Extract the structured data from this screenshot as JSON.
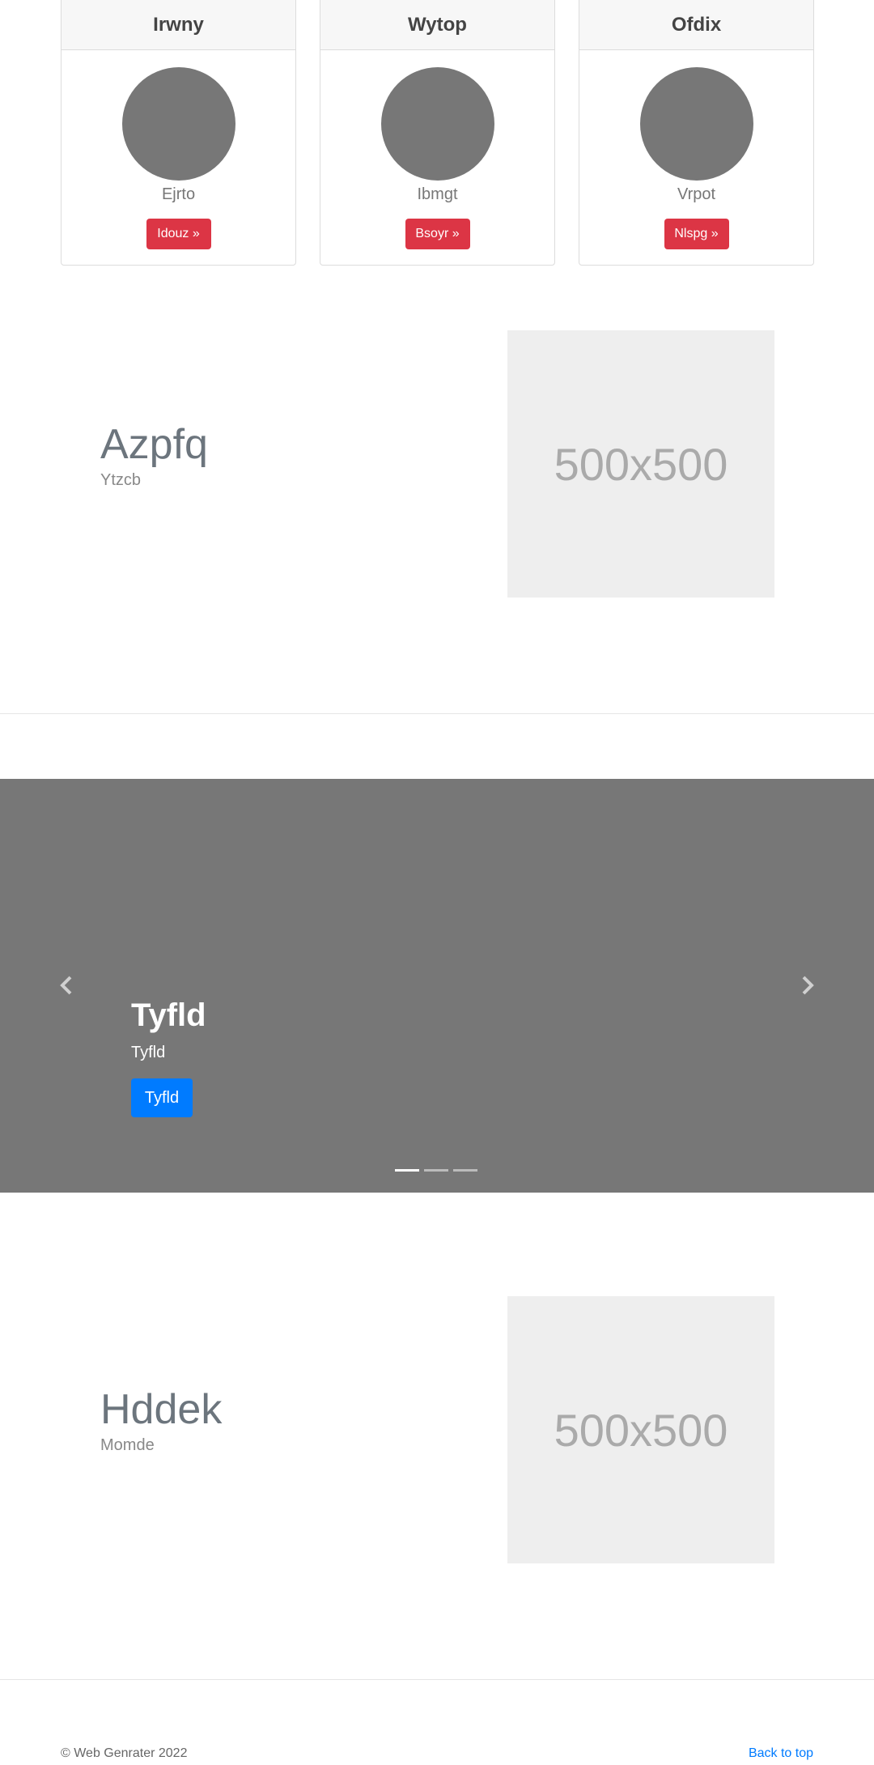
{
  "cards": [
    {
      "title": "Irwny",
      "name": "Ejrto",
      "button": "Idouz »"
    },
    {
      "title": "Wytop",
      "name": "Ibmgt",
      "button": "Bsoyr »"
    },
    {
      "title": "Ofdix",
      "name": "Vrpot",
      "button": "Nlspg »"
    }
  ],
  "feature1": {
    "title": "Azpfq",
    "subtitle": "Ytzcb",
    "image_label": "500x500"
  },
  "carousel": {
    "caption_title": "Tyfld",
    "caption_text": "Tyfld",
    "caption_button": "Tyfld",
    "prev_icon": "chevron-left-icon",
    "next_icon": "chevron-right-icon",
    "slide_count": 3,
    "active_index": 0
  },
  "feature2": {
    "title": "Hddek",
    "subtitle": "Momde",
    "image_label": "500x500"
  },
  "footer": {
    "copyright": "© Web Genrater 2022",
    "back_to_top": "Back to top"
  },
  "colors": {
    "danger": "#dc3545",
    "primary": "#007bff",
    "carousel_bg": "#777777",
    "placeholder_bg": "#eeeeee"
  }
}
